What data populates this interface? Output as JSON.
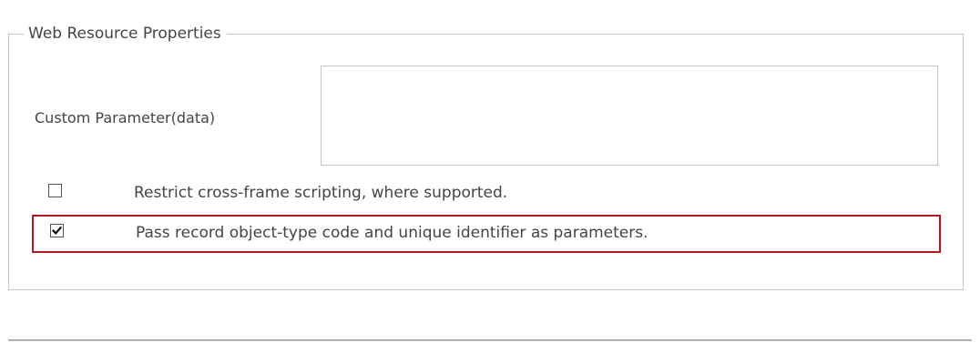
{
  "section": {
    "title": "Web Resource Properties"
  },
  "custom_parameter": {
    "label": "Custom Parameter(data)",
    "value": ""
  },
  "options": [
    {
      "label": "Restrict cross-frame scripting, where supported.",
      "checked": false
    },
    {
      "label": "Pass record object-type code and unique identifier as parameters.",
      "checked": true,
      "highlight_color": "#b3151c"
    }
  ],
  "colors": {
    "text": "#444444",
    "border": "#c6c6c6",
    "highlight": "#b3151c"
  }
}
